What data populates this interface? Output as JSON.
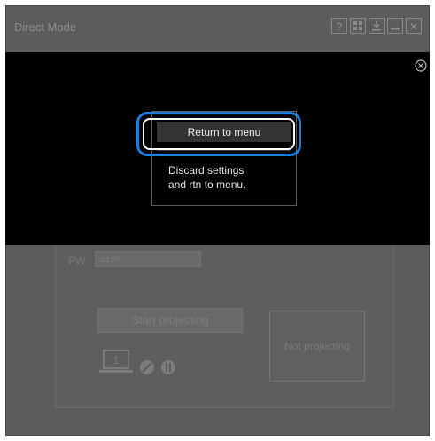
{
  "window": {
    "title": "Direct Mode"
  },
  "titlebar_buttons": [
    {
      "icon": "help-icon",
      "glyph": "?"
    },
    {
      "icon": "grid-icon"
    },
    {
      "icon": "download-icon"
    },
    {
      "icon": "minimize-icon"
    },
    {
      "icon": "close-icon",
      "glyph": "✕"
    }
  ],
  "form": {
    "pw_label": "PW",
    "pw_value": "2196",
    "start_button": "Start projecting",
    "status_text": "Not projecting",
    "screen_number": "1"
  },
  "popup": {
    "return_label": "Return to menu",
    "discard_line1": "Discard settings",
    "discard_line2": "and rtn to menu."
  },
  "colors": {
    "highlight_ring": "#1f7de0",
    "overlay": "#000000",
    "window_bg": "#5c5c5c"
  }
}
